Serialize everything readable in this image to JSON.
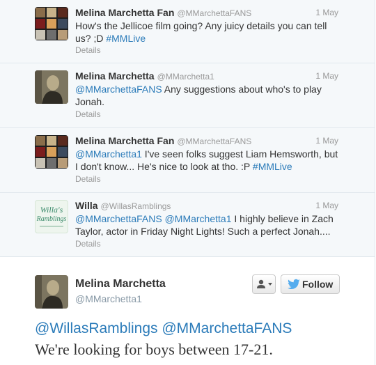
{
  "tweets": [
    {
      "name": "Melina Marchetta Fan",
      "handle": "@MMarchettaFANS",
      "date": "1 May",
      "text_plain": "How's the Jellicoe film going? Any juicy details you can tell us? ;D ",
      "text_link": "#MMLive",
      "details": "Details"
    },
    {
      "name": "Melina Marchetta",
      "handle": "@MMarchetta1",
      "date": "1 May",
      "text_link": "@MMarchettaFANS",
      "text_plain": " Any suggestions about who's to play Jonah.",
      "details": "Details"
    },
    {
      "name": "Melina Marchetta Fan",
      "handle": "@MMarchettaFANS",
      "date": "1 May",
      "text_link": "@MMarchetta1",
      "text_plain": " I've seen folks suggest Liam Hemsworth, but I don't know... He's nice to look at tho. :P ",
      "text_link2": "#MMLive",
      "details": "Details"
    },
    {
      "name": "Willa",
      "handle": "@WillasRamblings",
      "date": "1 May",
      "text_link": "@MMarchettaFANS @MMarchetta1",
      "text_plain": " I highly believe in Zach Taylor, actor in Friday Night Lights! Such a perfect Jonah....",
      "details": "Details",
      "avatar_line1": "Willa's",
      "avatar_line2": "Ramblings"
    }
  ],
  "main_tweet": {
    "name": "Melina Marchetta",
    "handle": "@MMarchetta1",
    "follow_label": "Follow",
    "mentions": "@WillasRamblings @MMarchettaFANS",
    "text": "We're looking for boys between 17-21."
  },
  "colors": {
    "link": "#2b7bb9",
    "bird": "#55acee"
  }
}
